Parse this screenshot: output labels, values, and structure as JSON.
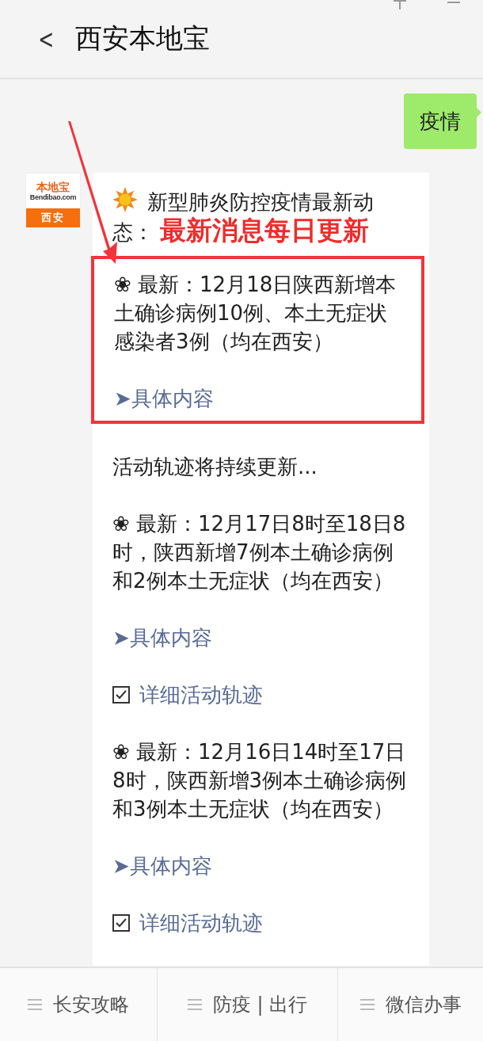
{
  "header": {
    "back": "<",
    "title": "西安本地宝"
  },
  "messages": [
    {
      "kind": "user",
      "text": "疫情"
    },
    {
      "kind": "bot",
      "avatar": {
        "brand": "本地宝",
        "site": "Bendibao.com",
        "city": "西安"
      },
      "intro": {
        "text": "新型肺炎防控疫情最新动态：",
        "highlight": "最新消息每日更新"
      },
      "entries": [
        {
          "kind": "news",
          "text": "❀ 最新：12月18日陕西新增本土确诊病例10例、本土无症状感染者3例（均在西安）",
          "link": "➤具体内容",
          "boxed": true
        },
        {
          "kind": "note",
          "text": "活动轨迹将持续更新..."
        },
        {
          "kind": "news",
          "text": "❀ 最新：12月17日8时至18日8时，陕西新增7例本土确诊病例和2例本土无症状（均在西安）",
          "link": "➤具体内容",
          "boxed": false
        },
        {
          "kind": "track",
          "label": "详细活动轨迹",
          "checked": true
        },
        {
          "kind": "news",
          "text": "❀ 最新：12月16日14时至17日8时，陕西新增3例本土确诊病例和3例本土无症状（均在西安）",
          "link": "➤具体内容",
          "boxed": false
        },
        {
          "kind": "track",
          "label": "详细活动轨迹",
          "checked": true
        }
      ]
    }
  ],
  "tab_bar": [
    {
      "label": "长安攻略"
    },
    {
      "label": "防疫 | 出行"
    },
    {
      "label": "微信办事"
    }
  ]
}
